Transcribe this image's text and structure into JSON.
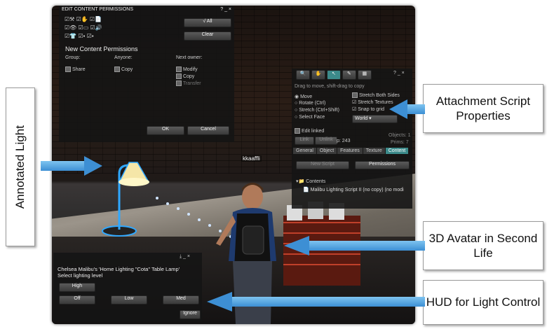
{
  "permissions_panel": {
    "title": "EDIT CONTENT PERMISSIONS",
    "title_controls": "? _ ×",
    "all_button": "√ All",
    "clear_button": "Clear",
    "new_perm_title": "New Content Permissions",
    "group_label": "Group:",
    "anyone_label": "Anyone:",
    "next_owner_label": "Next owner:",
    "share_label": "Share",
    "copy_label": "Copy",
    "modify_label": "Modify",
    "copy2_label": "Copy",
    "transfer_label": "Transfer",
    "ok_button": "OK",
    "cancel_button": "Cancel"
  },
  "build_panel": {
    "title_controls": "? _ ×",
    "hint": "Drag to move, shift-drag to copy",
    "modes": [
      "Move",
      "Rotate (Ctrl)",
      "Stretch (Ctrl+Shift)",
      "Select Face"
    ],
    "stretch_both": "Stretch Both Sides",
    "stretch_textures": "Stretch Textures",
    "snap_to_grid": "Snap to grid",
    "world_select": "World",
    "edit_linked": "Edit linked",
    "link_button": "Link",
    "unlink_button": "Unlink",
    "objects": "Objects: 1",
    "prims": "Prims: 7",
    "p_value": "p: 243",
    "tabs": [
      "General",
      "Object",
      "Features",
      "Texture",
      "Content"
    ],
    "active_tab": "Content",
    "new_script_button": "New Script",
    "permissions_button": "Permissions",
    "contents_label": "Contents",
    "script_item": "Malibu Lighting Script II (no copy) (no modi"
  },
  "name_tag": "kkaaffli",
  "hud": {
    "title_controls": "⤓ _ ×",
    "message": "Chelsea Malibu's 'Home Lighting \"Cota\" Table Lamp'",
    "prompt": "Select lighting level",
    "high_button": "High",
    "off_button": "Off",
    "low_button": "Low",
    "med_button": "Med",
    "ignore_button": "Ignore"
  },
  "callouts": {
    "annotated_light": "Annotated Light",
    "attachment_script": "Attachment Script Properties",
    "avatar": "3D Avatar in Second Life",
    "hud": "HUD for Light Control"
  },
  "colors": {
    "arrow": "#4a9be0",
    "active_tab": "#3c8a8a",
    "lamp_glow": "#2fa8ff"
  }
}
